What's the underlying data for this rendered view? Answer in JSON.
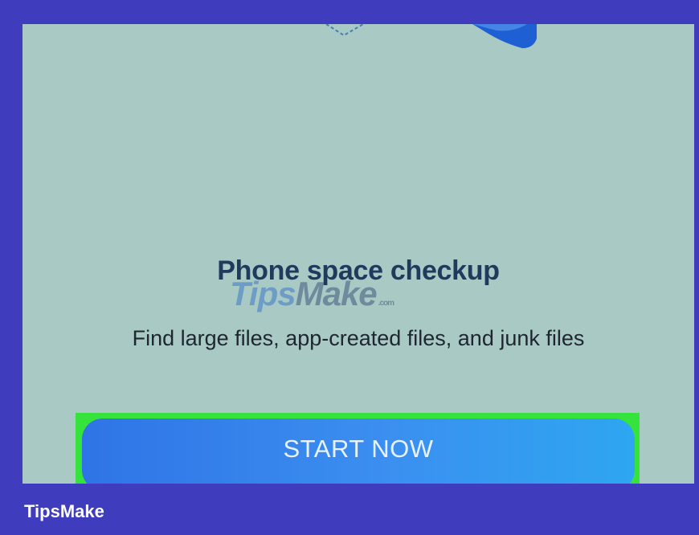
{
  "screen": {
    "title": "Phone space checkup",
    "subtitle": "Find large files, app-created files, and junk files",
    "start_button_label": "START NOW"
  },
  "watermark": {
    "part1": "Tips",
    "part2": "Make",
    "suffix": ".com"
  },
  "brand": {
    "name": "TipsMake"
  },
  "colors": {
    "frame": "#3f3dbd",
    "screen_background": "#a9c9c4",
    "title_text": "#1f3a5c",
    "button_blue": "#2f74e6",
    "highlight_green": "#36e23c"
  },
  "icons": [
    "illustration-graphic"
  ]
}
